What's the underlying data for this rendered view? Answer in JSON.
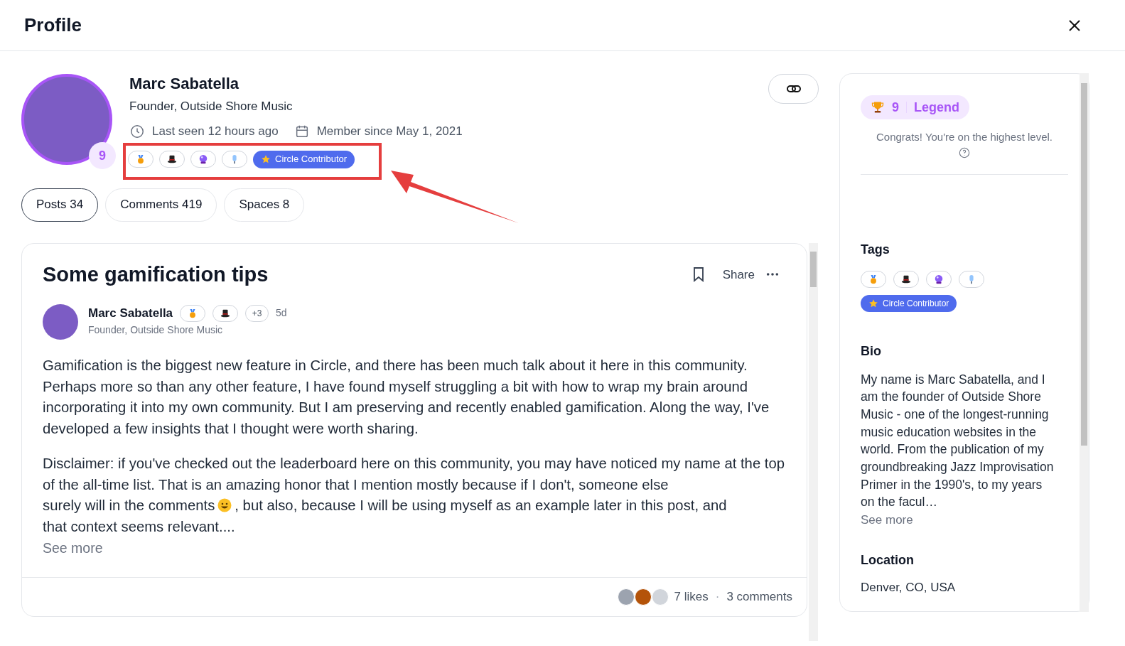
{
  "header": {
    "title": "Profile"
  },
  "profile": {
    "name": "Marc Sabatella",
    "headline": "Founder, Outside Shore Music",
    "level": "9",
    "last_seen": "Last seen 12 hours ago",
    "member_since": "Member since May 1, 2021",
    "badges": [
      {
        "kind": "medal"
      },
      {
        "kind": "top-hat"
      },
      {
        "kind": "crystal-ball"
      },
      {
        "kind": "microphone"
      },
      {
        "kind": "tag",
        "label": "Circle Contributor"
      }
    ]
  },
  "tabs": [
    {
      "label": "Posts 34",
      "selected": true
    },
    {
      "label": "Comments 419",
      "selected": false
    },
    {
      "label": "Spaces 8",
      "selected": false
    }
  ],
  "post": {
    "title": "Some gamification tips",
    "share": "Share",
    "author": {
      "name": "Marc Sabatella",
      "headline": "Founder, Outside Shore Music",
      "time": "5d",
      "badges": [
        {
          "kind": "medal"
        },
        {
          "kind": "top-hat"
        },
        {
          "kind": "more",
          "label": "+3"
        }
      ]
    },
    "paragraphs": [
      {
        "segments": [
          {
            "kind": "text",
            "text": "Gamification is the biggest new feature in Circle, and there has been much talk about it here in this community. Perhaps more so than any other feature, I have found myself struggling a bit with how to wrap my brain around incorporating it into my own community. But I am preserving and recently enabled gamification. Along the way, I've developed a few insights that I thought were worth sharing."
          }
        ]
      },
      {
        "segments": [
          {
            "kind": "text",
            "text": "Disclaimer: if you've checked out the leaderboard here on this community, you may have noticed my name at the top of the all-time list. That is an amazing honor that I mention mostly because if I don't, someone else"
          },
          {
            "kind": "inline",
            "text": "surely will in the comments"
          },
          {
            "kind": "smiley"
          },
          {
            "kind": "inline",
            "text": ", but also, because I will be using myself as an example later in this post, and"
          },
          {
            "kind": "text",
            "text": "that context seems relevant...."
          }
        ]
      }
    ],
    "see_more": "See more",
    "likes": "7 likes",
    "separator": "·",
    "comments": "3 comments"
  },
  "sidebar": {
    "level": "9",
    "level_name": "Legend",
    "congrats": "Congrats! You're on the highest level.",
    "tags_title": "Tags",
    "tags": [
      {
        "kind": "medal"
      },
      {
        "kind": "top-hat"
      },
      {
        "kind": "crystal-ball"
      },
      {
        "kind": "microphone"
      },
      {
        "kind": "tag",
        "label": "Circle Contributor"
      }
    ],
    "bio_title": "Bio",
    "bio": "My name is Marc Sabatella, and I am the founder of Outside Shore Music - one of the longest-running music education websites in the world. From the publication of my groundbreaking Jazz Improvisation Primer in the 1990's, to my years on the facul…",
    "bio_more": "See more",
    "location_title": "Location",
    "location": "Denver, CO, USA"
  }
}
